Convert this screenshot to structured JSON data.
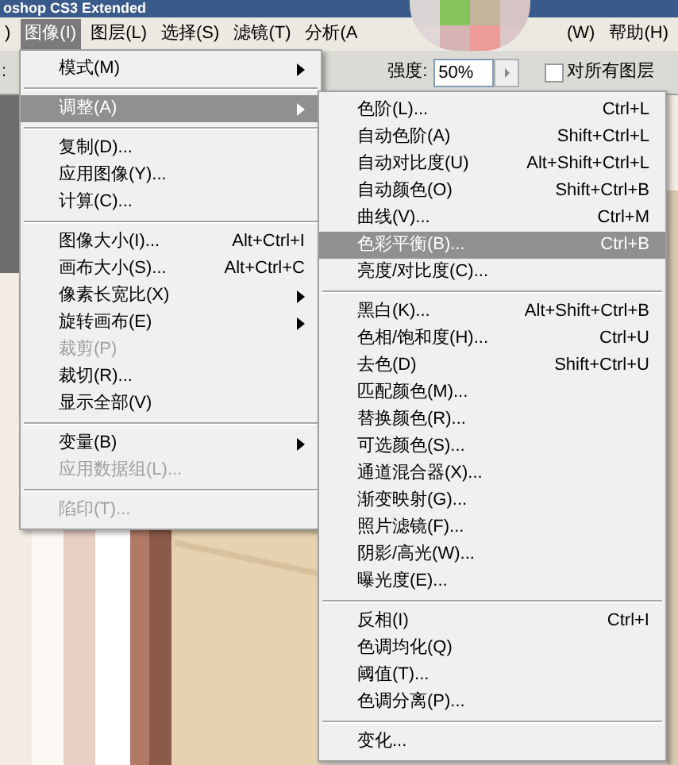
{
  "window": {
    "title": "oshop CS3 Extended"
  },
  "menubar": [
    {
      "label": ")",
      "selected": false
    },
    {
      "label": "图像(I)",
      "selected": true
    },
    {
      "label": "图层(L)",
      "selected": false
    },
    {
      "label": "选择(S)",
      "selected": false
    },
    {
      "label": "滤镜(T)",
      "selected": false
    },
    {
      "label": "分析(A",
      "selected": false
    },
    {
      "label": "(W)",
      "selected": false
    },
    {
      "label": "帮助(H)",
      "selected": false
    }
  ],
  "options_bar": {
    "cut_label": ":",
    "strength_label": "强度:",
    "strength_value": "50%",
    "all_layers": {
      "label": "对所有图层",
      "checked": false
    }
  },
  "image_menu": [
    {
      "kind": "item",
      "label": "模式(M)",
      "submenu": true,
      "disabled": false,
      "selected": false
    },
    {
      "kind": "separator"
    },
    {
      "kind": "item",
      "label": "调整(A)",
      "submenu": true,
      "disabled": false,
      "selected": true
    },
    {
      "kind": "separator"
    },
    {
      "kind": "item",
      "label": "复制(D)...",
      "disabled": false,
      "selected": false
    },
    {
      "kind": "item",
      "label": "应用图像(Y)...",
      "disabled": false,
      "selected": false
    },
    {
      "kind": "item",
      "label": "计算(C)...",
      "disabled": false,
      "selected": false
    },
    {
      "kind": "separator"
    },
    {
      "kind": "item",
      "label": "图像大小(I)...",
      "shortcut": "Alt+Ctrl+I",
      "disabled": false,
      "selected": false
    },
    {
      "kind": "item",
      "label": "画布大小(S)...",
      "shortcut": "Alt+Ctrl+C",
      "disabled": false,
      "selected": false
    },
    {
      "kind": "item",
      "label": "像素长宽比(X)",
      "submenu": true,
      "disabled": false,
      "selected": false
    },
    {
      "kind": "item",
      "label": "旋转画布(E)",
      "submenu": true,
      "disabled": false,
      "selected": false
    },
    {
      "kind": "item",
      "label": "裁剪(P)",
      "disabled": true,
      "selected": false
    },
    {
      "kind": "item",
      "label": "裁切(R)...",
      "disabled": false,
      "selected": false
    },
    {
      "kind": "item",
      "label": "显示全部(V)",
      "disabled": false,
      "selected": false
    },
    {
      "kind": "separator"
    },
    {
      "kind": "item",
      "label": "变量(B)",
      "submenu": true,
      "disabled": false,
      "selected": false
    },
    {
      "kind": "item",
      "label": "应用数据组(L)...",
      "disabled": true,
      "selected": false
    },
    {
      "kind": "separator"
    },
    {
      "kind": "item",
      "label": "陷印(T)...",
      "disabled": true,
      "selected": false
    }
  ],
  "adjust_menu": [
    {
      "kind": "item",
      "label": "色阶(L)...",
      "shortcut": "Ctrl+L",
      "selected": false
    },
    {
      "kind": "item",
      "label": "自动色阶(A)",
      "shortcut": "Shift+Ctrl+L",
      "selected": false
    },
    {
      "kind": "item",
      "label": "自动对比度(U)",
      "shortcut": "Alt+Shift+Ctrl+L",
      "selected": false
    },
    {
      "kind": "item",
      "label": "自动颜色(O)",
      "shortcut": "Shift+Ctrl+B",
      "selected": false
    },
    {
      "kind": "item",
      "label": "曲线(V)...",
      "shortcut": "Ctrl+M",
      "selected": false
    },
    {
      "kind": "item",
      "label": "色彩平衡(B)...",
      "shortcut": "Ctrl+B",
      "selected": true
    },
    {
      "kind": "item",
      "label": "亮度/对比度(C)...",
      "selected": false
    },
    {
      "kind": "separator"
    },
    {
      "kind": "item",
      "label": "黑白(K)...",
      "shortcut": "Alt+Shift+Ctrl+B",
      "selected": false
    },
    {
      "kind": "item",
      "label": "色相/饱和度(H)...",
      "shortcut": "Ctrl+U",
      "selected": false
    },
    {
      "kind": "item",
      "label": "去色(D)",
      "shortcut": "Shift+Ctrl+U",
      "selected": false
    },
    {
      "kind": "item",
      "label": "匹配颜色(M)...",
      "selected": false
    },
    {
      "kind": "item",
      "label": "替换颜色(R)...",
      "selected": false
    },
    {
      "kind": "item",
      "label": "可选颜色(S)...",
      "selected": false
    },
    {
      "kind": "item",
      "label": "通道混合器(X)...",
      "selected": false
    },
    {
      "kind": "item",
      "label": "渐变映射(G)...",
      "selected": false
    },
    {
      "kind": "item",
      "label": "照片滤镜(F)...",
      "selected": false
    },
    {
      "kind": "item",
      "label": "阴影/高光(W)...",
      "selected": false
    },
    {
      "kind": "item",
      "label": "曝光度(E)...",
      "selected": false
    },
    {
      "kind": "separator"
    },
    {
      "kind": "item",
      "label": "反相(I)",
      "shortcut": "Ctrl+I",
      "selected": false
    },
    {
      "kind": "item",
      "label": "色调均化(Q)",
      "selected": false
    },
    {
      "kind": "item",
      "label": "阈值(T)...",
      "selected": false
    },
    {
      "kind": "item",
      "label": "色调分离(P)...",
      "selected": false
    },
    {
      "kind": "separator"
    },
    {
      "kind": "item",
      "label": "变化...",
      "selected": false
    }
  ]
}
